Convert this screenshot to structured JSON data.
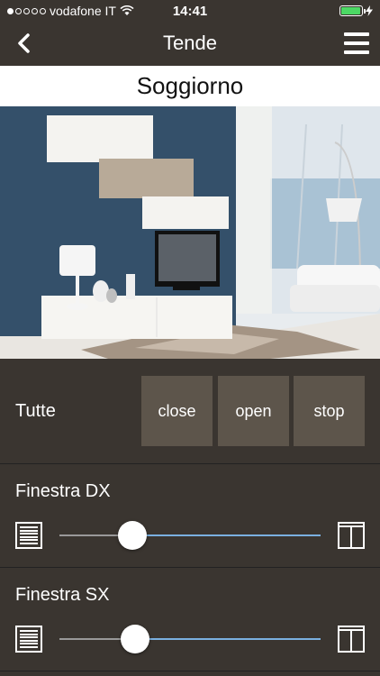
{
  "status": {
    "carrier": "vodafone IT",
    "time": "14:41",
    "signal_bars_filled": 1,
    "signal_bars_total": 5,
    "battery_level": 0.95,
    "battery_color": "#4cd964"
  },
  "nav": {
    "title": "Tende",
    "back_icon": "chevron-left-icon",
    "menu_icon": "hamburger-menu-icon"
  },
  "room": {
    "name": "Soggiorno"
  },
  "all": {
    "label": "Tutte",
    "close_label": "close",
    "open_label": "open",
    "stop_label": "stop"
  },
  "blinds": [
    {
      "label": "Finestra DX",
      "position": 0.28
    },
    {
      "label": "Finestra SX",
      "position": 0.29
    }
  ],
  "colors": {
    "background": "#3a3530",
    "button": "#5d554b",
    "slider_active": "#7ab0e0",
    "slider_inactive": "#999999"
  }
}
